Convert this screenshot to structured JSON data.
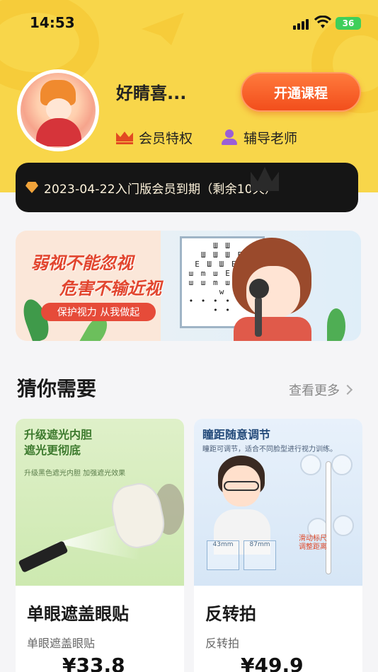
{
  "status_bar": {
    "time": "14:53",
    "battery": "36"
  },
  "profile": {
    "username": "好睛喜...",
    "open_course_label": "开通课程",
    "perks": [
      {
        "icon": "crown-icon",
        "label": "会员特权"
      },
      {
        "icon": "teacher-icon",
        "label": "辅导老师"
      }
    ]
  },
  "membership": {
    "text": "2023-04-22入门版会员到期（剩余10天）"
  },
  "banner": {
    "title_line1": "弱视不能忽视",
    "title_line2": "危害不输近视",
    "pill": "保护视力 从我做起",
    "chart_rows": [
      "Ш Ш",
      "Ш Ш Ш E",
      "E Ш Ш E Ш",
      "ш m ш E m ш",
      "ш ш m ш ш ш w",
      "• • • • • • • •"
    ]
  },
  "section": {
    "title": "猜你需要",
    "see_more": "查看更多"
  },
  "products": [
    {
      "img_title": "升级遮光内胆\n遮光更彻底",
      "img_title_line1": "升级遮光内胆",
      "img_title_line2": "遮光更彻底",
      "img_sub": "升级黑色遮光内胆 加强遮光效果",
      "name": "单眼遮盖眼贴",
      "desc": "单眼遮盖眼贴",
      "price": "¥33.8"
    },
    {
      "img_title": "瞳距随意调节",
      "img_sub": "瞳距可调节，适合不同脸型进行视力训练。",
      "slide_label_1": "滑动标尺",
      "slide_label_2": "调整距离",
      "mm_left": "43mm",
      "mm_right": "87mm",
      "name": "反转拍",
      "desc": "反转拍",
      "price": "¥49.9"
    }
  ],
  "colors": {
    "header_yellow": "#f8d64a",
    "accent_orange": "#f24e1c",
    "member_bar": "#151515"
  }
}
